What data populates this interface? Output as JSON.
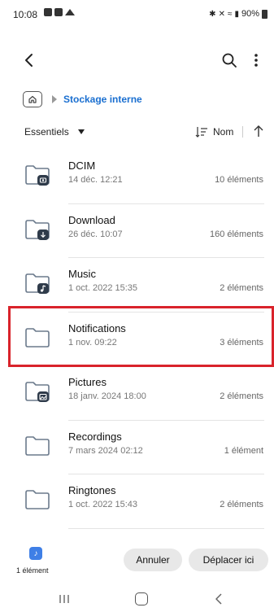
{
  "status": {
    "time": "10:08",
    "battery": "90%",
    "signal_text": "✱ ✕ ≈ ‶.∣"
  },
  "breadcrumb": {
    "label": "Stockage interne"
  },
  "sort": {
    "filter_label": "Essentiels",
    "sort_label": "Nom"
  },
  "folders": [
    {
      "name": "DCIM",
      "date": "14 déc. 12:21",
      "count": "10 éléments",
      "badge": "camera-badge"
    },
    {
      "name": "Download",
      "date": "26 déc. 10:07",
      "count": "160 éléments",
      "badge": "download-badge"
    },
    {
      "name": "Music",
      "date": "1 oct. 2022 15:35",
      "count": "2 éléments",
      "badge": "music-badge"
    },
    {
      "name": "Notifications",
      "date": "1 nov. 09:22",
      "count": "3 éléments",
      "badge": ""
    },
    {
      "name": "Pictures",
      "date": "18 janv. 2024 18:00",
      "count": "2 éléments",
      "badge": "image-badge"
    },
    {
      "name": "Recordings",
      "date": "7 mars 2024 02:12",
      "count": "1 élément",
      "badge": ""
    },
    {
      "name": "Ringtones",
      "date": "1 oct. 2022 15:43",
      "count": "2 éléments",
      "badge": ""
    }
  ],
  "bottom": {
    "selected_label": "1 élément",
    "cancel_label": "Annuler",
    "move_label": "Déplacer ici"
  },
  "colors": {
    "accent": "#1a6fd0",
    "highlight": "#d9232b",
    "folder": "#6b7a8c"
  }
}
